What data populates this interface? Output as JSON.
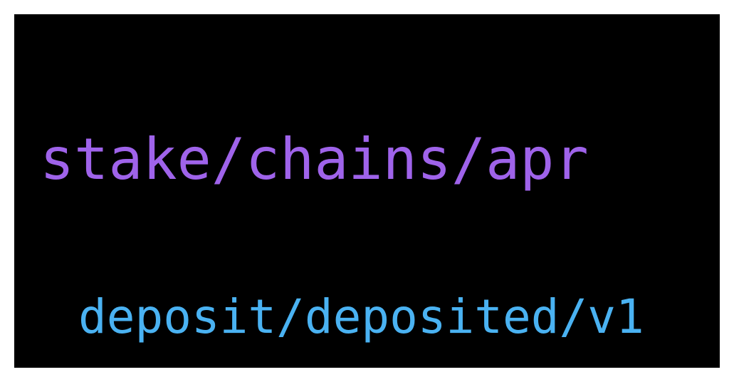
{
  "lines": [
    {
      "text": "stake/chains/apr",
      "color": "#9f63ea"
    },
    {
      "text": "deposit/deposited/v1",
      "color": "#4ab2f2"
    }
  ],
  "background": "#000000"
}
